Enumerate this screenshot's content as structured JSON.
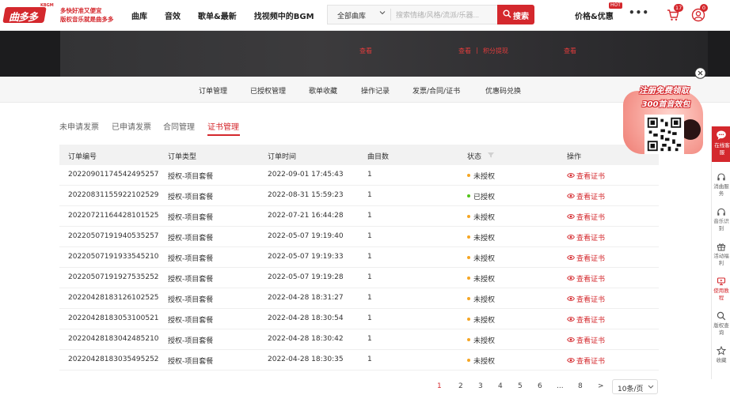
{
  "brand": {
    "logo_text": "曲多多",
    "logo_tag": "KBGM",
    "slogan_line1": "多快好准又便宜",
    "slogan_line2": "版权音乐就是曲多多"
  },
  "nav": {
    "items": [
      "曲库",
      "音效",
      "歌单&最新",
      "找视频中的BGM"
    ]
  },
  "search": {
    "category": "全部曲库",
    "placeholder": "搜索情绪/风格/流派/乐器...",
    "button_label": "搜索"
  },
  "header_right": {
    "pricing": "价格&优惠",
    "hot_badge": "HOT",
    "more": "•••",
    "cart_count": "17",
    "user_count": "0"
  },
  "banner": {
    "link_1": "查看",
    "link_2": "查看",
    "link_3": "积分提现",
    "link_4": "查看",
    "separator": "|"
  },
  "subnav": {
    "items": [
      "订单管理",
      "已授权管理",
      "歌单收藏",
      "操作记录",
      "发票/合同/证书",
      "优惠码兑换"
    ]
  },
  "tabs": {
    "items": [
      "未申请发票",
      "已申请发票",
      "合同管理",
      "证书管理"
    ]
  },
  "table": {
    "headers": [
      "订单编号",
      "订单类型",
      "订单时间",
      "曲目数",
      "状态",
      "操作"
    ],
    "rows": [
      {
        "id": "20220901174542495257",
        "type": "授权-项目套餐",
        "time": "2022-09-01 17:45:43",
        "count": "1",
        "status": "未授权",
        "action": "查看证书"
      },
      {
        "id": "20220831155922102529",
        "type": "授权-项目套餐",
        "time": "2022-08-31 15:59:23",
        "count": "1",
        "status": "已授权",
        "action": "查看证书"
      },
      {
        "id": "20220721164428101525",
        "type": "授权-项目套餐",
        "time": "2022-07-21 16:44:28",
        "count": "1",
        "status": "未授权",
        "action": "查看证书"
      },
      {
        "id": "20220507191940535257",
        "type": "授权-项目套餐",
        "time": "2022-05-07 19:19:40",
        "count": "1",
        "status": "未授权",
        "action": "查看证书"
      },
      {
        "id": "20220507191933545210",
        "type": "授权-项目套餐",
        "time": "2022-05-07 19:19:33",
        "count": "1",
        "status": "未授权",
        "action": "查看证书"
      },
      {
        "id": "20220507191927535252",
        "type": "授权-项目套餐",
        "time": "2022-05-07 19:19:28",
        "count": "1",
        "status": "未授权",
        "action": "查看证书"
      },
      {
        "id": "20220428183126102525",
        "type": "授权-项目套餐",
        "time": "2022-04-28 18:31:27",
        "count": "1",
        "status": "未授权",
        "action": "查看证书"
      },
      {
        "id": "20220428183053100521",
        "type": "授权-项目套餐",
        "time": "2022-04-28 18:30:54",
        "count": "1",
        "status": "未授权",
        "action": "查看证书"
      },
      {
        "id": "20220428183042485210",
        "type": "授权-项目套餐",
        "time": "2022-04-28 18:30:42",
        "count": "1",
        "status": "未授权",
        "action": "查看证书"
      },
      {
        "id": "20220428183035495252",
        "type": "授权-项目套餐",
        "time": "2022-04-28 18:30:35",
        "count": "1",
        "status": "未授权",
        "action": "查看证书"
      }
    ]
  },
  "pagination": {
    "pages": [
      "1",
      "2",
      "3",
      "4",
      "5",
      "6",
      "...",
      "8",
      ">"
    ],
    "page_size": "10条/页"
  },
  "promo": {
    "title": "注册免费领取",
    "subtitle": "300首音效包"
  },
  "sidebar": {
    "items": [
      {
        "label": "在线客服"
      },
      {
        "label": "消曲服务"
      },
      {
        "label": "音乐识别"
      },
      {
        "label": "活动福利"
      },
      {
        "label": "使用教程"
      },
      {
        "label": "版权查询"
      },
      {
        "label": "收藏"
      }
    ]
  },
  "colors": {
    "brand_red": "#d4282d",
    "status_pending": "#f5a623",
    "status_done": "#52c41a"
  }
}
